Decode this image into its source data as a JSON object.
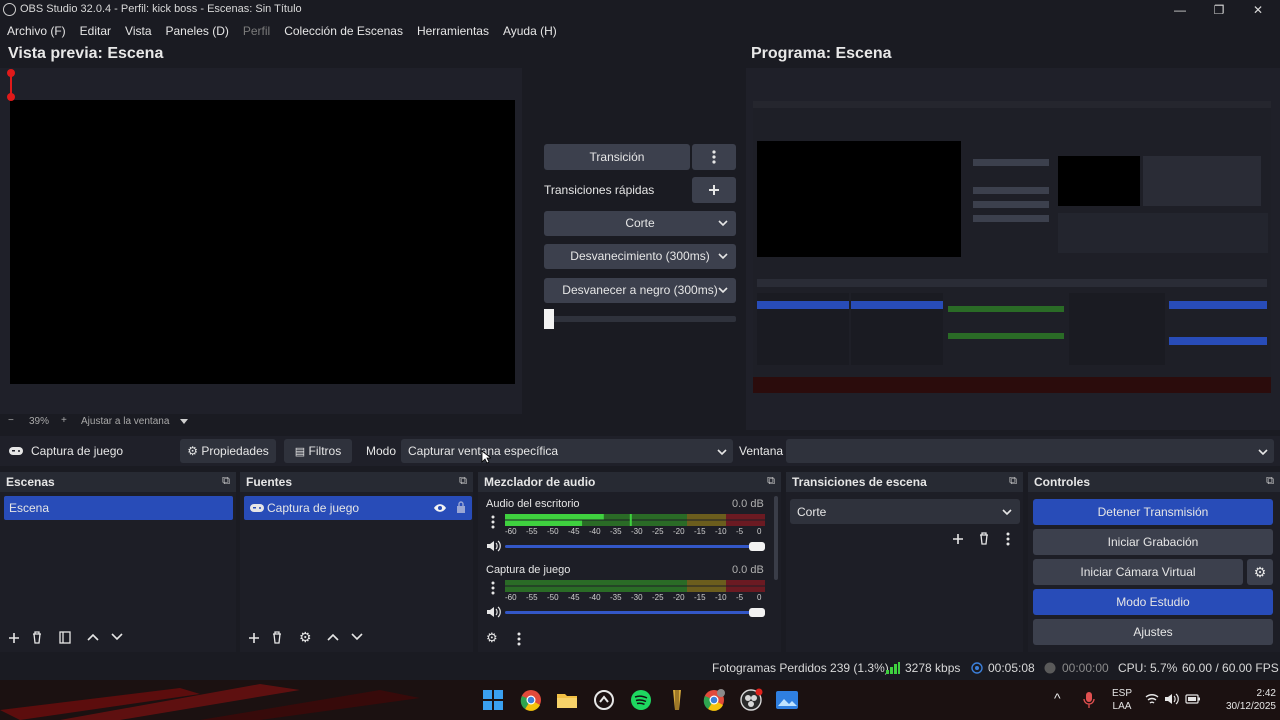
{
  "window": {
    "title": "OBS Studio 32.0.4 - Perfil: kick boss - Escenas: Sin Título",
    "minimize": "—",
    "maximize": "❐",
    "close": "✕"
  },
  "menu": {
    "items": [
      "Archivo (F)",
      "Editar",
      "Vista",
      "Paneles (D)",
      "Perfil",
      "Colección de Escenas",
      "Herramientas",
      "Ayuda (H)"
    ]
  },
  "preview": {
    "title": "Vista previa: Escena",
    "zoom_minus": "−",
    "zoom": "39%",
    "zoom_plus": "+",
    "fit": "Ajustar a la ventana"
  },
  "program": {
    "title": "Programa: Escena"
  },
  "transitions": {
    "transition_button": "Transición",
    "quick_label": "Transiciones rápidas",
    "items": [
      "Corte",
      "Desvanecimiento (300ms)",
      "Desvanecer a negro (300ms)"
    ],
    "t_bar_value": 0
  },
  "source_toolbar": {
    "source_name": "Captura de juego",
    "properties": "Propiedades",
    "filters": "Filtros",
    "mode_label": "Modo",
    "mode_value": "Capturar ventana específica",
    "window_label": "Ventana",
    "window_value": ""
  },
  "docks": {
    "scenes": {
      "title": "Escenas",
      "items": [
        "Escena"
      ]
    },
    "sources": {
      "title": "Fuentes",
      "items": [
        "Captura de juego"
      ]
    },
    "mixer": {
      "title": "Mezclador de audio",
      "channels": [
        {
          "name": "Audio del escritorio",
          "db": "0.0 dB",
          "level": 0.38,
          "volume": 1.0
        },
        {
          "name": "Captura de juego",
          "db": "0.0 dB",
          "level": 0.0,
          "volume": 1.0
        }
      ],
      "scale": [
        "-60",
        "-55",
        "-50",
        "-45",
        "-40",
        "-35",
        "-30",
        "-25",
        "-20",
        "-15",
        "-10",
        "-5",
        "0"
      ]
    },
    "scene_transitions": {
      "title": "Transiciones de escena",
      "selected": "Corte"
    },
    "controls": {
      "title": "Controles",
      "stop_stream": "Detener Transmisión",
      "start_recording": "Iniciar Grabación",
      "virtual_cam": "Iniciar Cámara Virtual",
      "studio_mode": "Modo Estudio",
      "settings": "Ajustes"
    }
  },
  "status": {
    "dropped_frames": "Fotogramas Perdidos 239 (1.3%)",
    "bitrate": "3278 kbps",
    "stream_time": "00:05:08",
    "rec_time": "00:00:00",
    "cpu": "CPU: 5.7%",
    "fps": "60.00 / 60.00 FPS"
  },
  "taskbar": {
    "lang": "ESP",
    "region": "LAA",
    "time": "2:42",
    "date": "30/12/2025",
    "chevron": "^"
  },
  "colors": {
    "accent": "#284cb8",
    "meter_green": "#3fd13f",
    "meter_green_dim": "#2a6b26",
    "meter_yellow_dim": "#6b5d1d",
    "meter_red_dim": "#6b1a22"
  }
}
